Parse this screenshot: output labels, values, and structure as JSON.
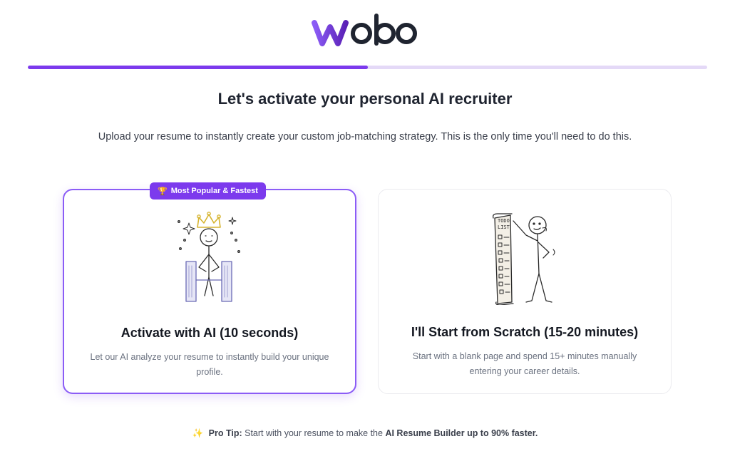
{
  "brand": {
    "logo_text": "wobo",
    "accent": "#7c3aed"
  },
  "progress": {
    "fraction": 0.5
  },
  "header": {
    "title": "Let's activate your personal AI recruiter",
    "subtitle": "Upload your resume to instantly create your custom job-matching strategy. This is the only time you'll need to do this."
  },
  "options": [
    {
      "badge": "Most Popular & Fastest",
      "badge_icon": "trophy-icon",
      "title": "Activate with AI (10 seconds)",
      "description": "Let our AI analyze your resume to instantly build your unique profile.",
      "illustration": "king-on-throne-icon"
    },
    {
      "title": "I'll Start from Scratch (15-20 minutes)",
      "description": "Start with a blank page and spend 15+ minutes manually entering your career details.",
      "illustration": "todo-list-person-icon",
      "list_heading": [
        "TODO",
        "LIST"
      ]
    }
  ],
  "tip": {
    "icon": "sparkle-icon",
    "label": "Pro Tip:",
    "text_before": "Start with your resume to make the",
    "highlight": "AI Resume Builder up to 90% faster."
  }
}
